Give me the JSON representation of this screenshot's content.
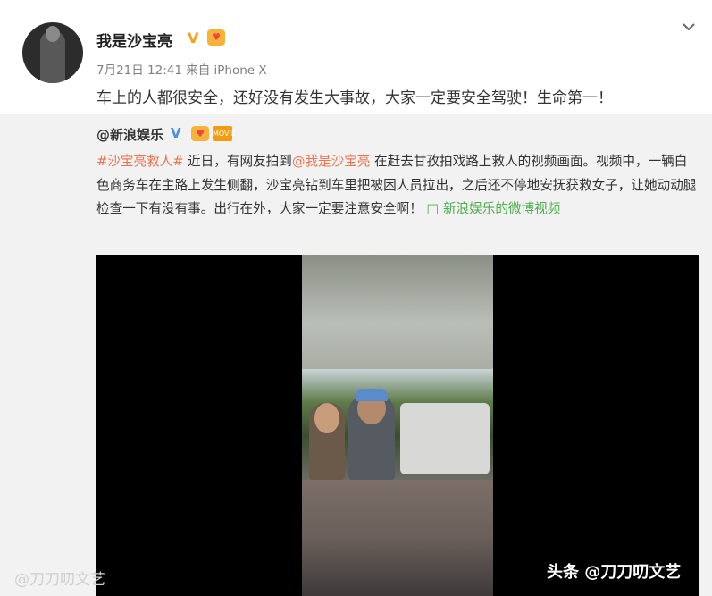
{
  "post": {
    "username": "我是沙宝亮",
    "verified_badge": "V",
    "meta": "7月21日 12:41 来自 iPhone X",
    "text": "车上的人都很安全，还好没有发生大事故，大家一定要安全驾驶！生命第一！"
  },
  "repost": {
    "username": "@新浪娱乐",
    "verified_badge": "V",
    "movie_badge": "MOVIE",
    "topic": "#沙宝亮救人#",
    "text_1": " 近日，有网友拍到",
    "mention": "@我是沙宝亮",
    "text_2": " 在赶去甘孜拍戏路上救人的视频画面。视频中，一辆白色商务车在主路上发生侧翻，沙宝亮钻到车里把被困人员拉出，之后还不停地安抚获救女子，让她动动腿检查一下有没有事。出行在外，大家一定要注意安全啊！ ",
    "video_link": "新浪娱乐的微博视频"
  },
  "watermarks": {
    "left": "@刀刀叨文艺",
    "right": "头条 @刀刀叨文艺"
  },
  "icons": {
    "chevron": "chevron-down-icon",
    "video_link_icon": "video-link-icon"
  },
  "colors": {
    "link": "#eb7350",
    "video_link": "#4cae4c",
    "verified_gold": "#f3a21c",
    "verified_blue": "#4a90e2"
  }
}
